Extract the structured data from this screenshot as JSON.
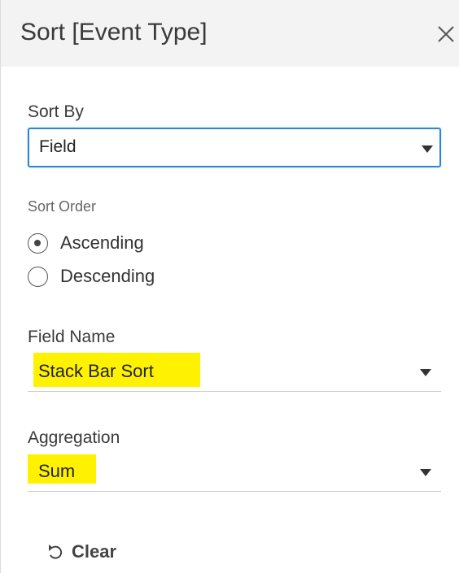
{
  "dialog": {
    "title": "Sort [Event Type]",
    "close_icon": "close-icon"
  },
  "sort_by": {
    "label": "Sort By",
    "value": "Field",
    "accent_color": "#2b87d3"
  },
  "sort_order": {
    "label": "Sort Order",
    "options": [
      {
        "label": "Ascending",
        "selected": true
      },
      {
        "label": "Descending",
        "selected": false
      }
    ]
  },
  "field_name": {
    "label": "Field Name",
    "value": "Stack Bar Sort",
    "highlight_color": "#fff200"
  },
  "aggregation": {
    "label": "Aggregation",
    "value": "Sum",
    "highlight_color": "#fff200"
  },
  "footer": {
    "clear_label": "Clear",
    "clear_icon": "undo-icon"
  }
}
